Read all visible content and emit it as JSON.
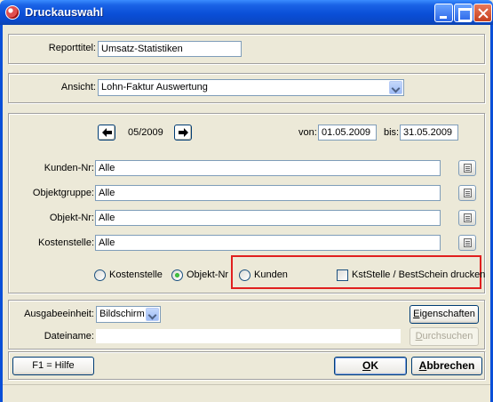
{
  "window": {
    "title": "Druckauswahl"
  },
  "report": {
    "label": "Reporttitel:",
    "value": "Umsatz-Statistiken"
  },
  "view": {
    "label": "Ansicht:",
    "value": "Lohn-Faktur Auswertung"
  },
  "period": {
    "month": "05/2009",
    "from_label": "von:",
    "from_value": "01.05.2009",
    "to_label": "bis:",
    "to_value": "31.05.2009"
  },
  "filters": [
    {
      "label": "Kunden-Nr:",
      "value": "Alle"
    },
    {
      "label": "Objektgruppe:",
      "value": "Alle"
    },
    {
      "label": "Objekt-Nr:",
      "value": "Alle"
    },
    {
      "label": "Kostenstelle:",
      "value": "Alle"
    }
  ],
  "grouping": {
    "kostenstelle": "Kostenstelle",
    "objekt": "Objekt-Nr",
    "kunden": "Kunden",
    "selected": "Objekt-Nr",
    "checkbox_label": "KstStelle / BestSchein drucken"
  },
  "output": {
    "label": "Ausgabeeinheit:",
    "value": "Bildschirm",
    "properties_prefix": "",
    "properties_u": "E",
    "properties_rest": "igenschaften",
    "filename_label": "Dateiname:",
    "filename_value": "",
    "browse_u": "D",
    "browse_rest": "urchsuchen"
  },
  "footer": {
    "help": "F1 = Hilfe",
    "ok_u": "O",
    "ok_rest": "K",
    "cancel_u": "A",
    "cancel_rest": "bbrechen"
  },
  "colors": {
    "highlight": "#e0201f",
    "titlebar": "#0a4fd8"
  }
}
